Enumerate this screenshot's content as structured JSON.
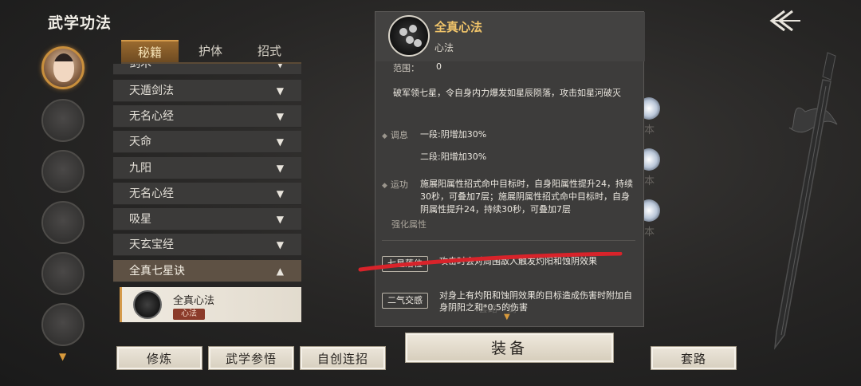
{
  "screen": {
    "title": "武学功法"
  },
  "tabs": [
    "秘籍",
    "护体",
    "招式"
  ],
  "list": {
    "items": [
      {
        "label": "剑术",
        "expanded": false
      },
      {
        "label": "天遁剑法",
        "expanded": false
      },
      {
        "label": "无名心经",
        "expanded": false
      },
      {
        "label": "天命",
        "expanded": false
      },
      {
        "label": "九阳",
        "expanded": false
      },
      {
        "label": "无名心经",
        "expanded": false
      },
      {
        "label": "吸星",
        "expanded": false
      },
      {
        "label": "天玄宝经",
        "expanded": false
      },
      {
        "label": "全真七星诀",
        "expanded": true
      }
    ],
    "sub_item": {
      "name": "全真心法",
      "tag": "心法"
    }
  },
  "detail": {
    "name": "全真心法",
    "type": "心法",
    "range_label": "范围：",
    "range_value": "0",
    "description": "破军领七星，令自身内力爆发如星辰陨落，攻击如星河破灭",
    "tiaoxi_label": "调息",
    "tiaoxi_1": "一段:阴增加30%",
    "tiaoxi_2": "二段:阳增加30%",
    "yungong_label": "运功",
    "yungong_text": "施展阳属性招式命中目标时，自身阳属性提升24，持续30秒，可叠加7层；施展阴属性招式命中目标时，自身阴属性提升24，持续30秒，可叠加7层",
    "enhance_header": "强化属性",
    "enhancements": [
      {
        "name": "七星落位",
        "text": "攻击时会对周围敌人触发灼阳和蚀阴效果"
      },
      {
        "name": "二气交感",
        "text": "对身上有灼阳和蚀阴效果的目标造成伤害时附加自身阴阳之和*0.5的伤害"
      }
    ]
  },
  "buttons": {
    "xiulian": "修炼",
    "wuxue_canwu": "武学参悟",
    "zichuang_lianzhao": "自创连招",
    "equip": "装备",
    "taolu": "套路"
  },
  "background_text": {
    "jian": "剑",
    "taolu": "套路",
    "ben1": "本",
    "ben2": "本",
    "ben3": "本"
  },
  "colors": {
    "accent": "#d49a4a",
    "gold_text": "#f0c46a",
    "red_mark": "#d8232a",
    "tag_red": "#8b3b2a"
  },
  "icons": [
    "back-arrow-icon",
    "chevron-down-icon",
    "chevron-up-icon",
    "scroll-down-icon",
    "sword-icon"
  ]
}
